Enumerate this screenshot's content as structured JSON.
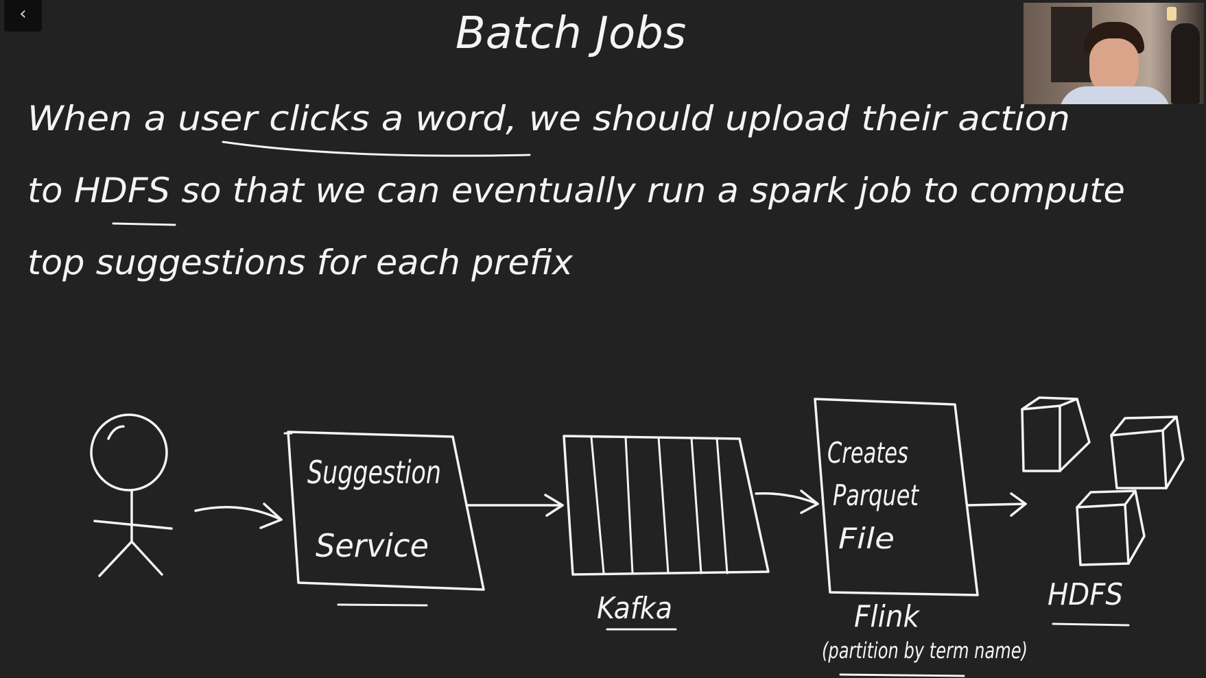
{
  "slide": {
    "title": "Batch Jobs",
    "body_lines": [
      "When a user clicks a word, we should upload their action",
      "to HDFS so that we can eventually run a spark job to compute",
      "top suggestions for each prefix"
    ]
  },
  "toolbar": {
    "back_glyph": "‹"
  },
  "diagram": {
    "service_label": [
      "Suggestion",
      "Service"
    ],
    "kafka_label": "Kafka",
    "flink_box_label": [
      "Creates",
      "Parquet",
      "File"
    ],
    "flink_label": "Flink",
    "flink_sublabel": "(partition by term name)",
    "hdfs_label": "HDFS"
  },
  "webcam": {
    "icon": "presenter-webcam"
  },
  "colors": {
    "background": "#222222",
    "ink": "#f4f4f4"
  }
}
